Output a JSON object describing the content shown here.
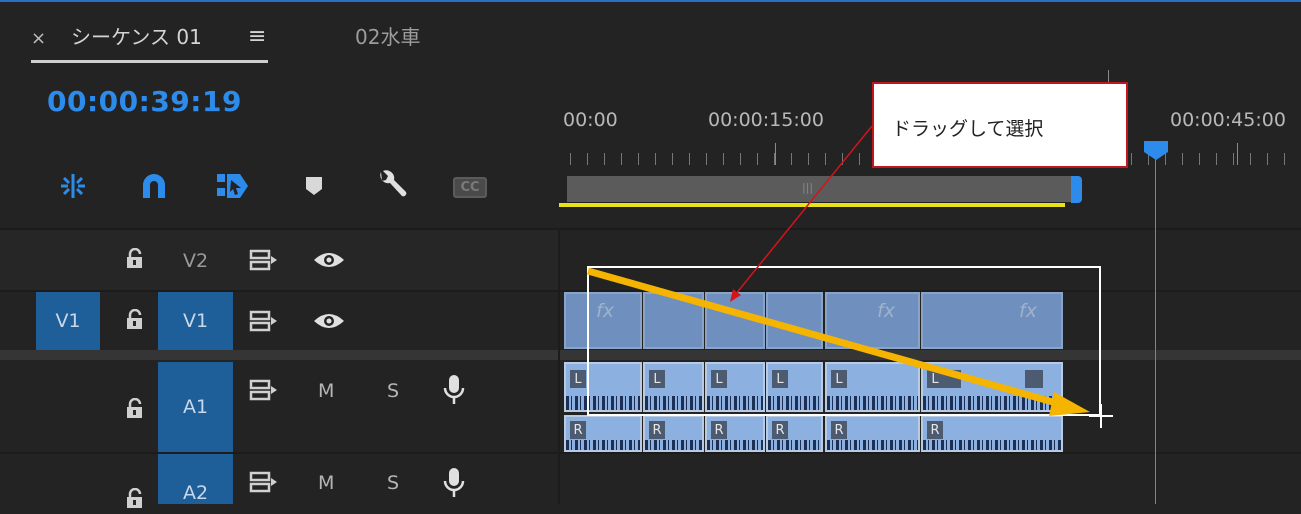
{
  "header": {
    "tabs": [
      {
        "close_symbol": "×",
        "label": "シーケンス 01",
        "menu_symbol": "≡"
      },
      {
        "label": "02水車"
      }
    ],
    "timecode": "00:00:39:19"
  },
  "toolbar": {
    "tools": [
      "snap-in-sequence-icon",
      "magnet-snap-icon",
      "linked-selection-icon",
      "add-marker-icon",
      "wrench-settings-icon",
      "closed-captions-icon"
    ],
    "cc_label": "CC"
  },
  "ruler": {
    "labels": [
      "00:00",
      "00:00:15:00",
      "00:00:45:00"
    ]
  },
  "tracks": {
    "v2": {
      "name": "V2"
    },
    "v1": {
      "target": "V1",
      "name": "V1"
    },
    "a1": {
      "name": "A1",
      "mute": "M",
      "solo": "S"
    },
    "a2": {
      "name": "A2",
      "mute": "M",
      "solo": "S"
    }
  },
  "clips": {
    "fx_label": "fx",
    "left_channel": "L",
    "right_channel": "R"
  },
  "annotation": {
    "callout_text": "ドラッグして選択"
  },
  "colors": {
    "accent_blue": "#2d8ceb",
    "track_target": "#1f5f99",
    "work_area_yellow": "#e9e11a",
    "arrow_orange": "#f5b400",
    "callout_border": "#c0161c"
  }
}
